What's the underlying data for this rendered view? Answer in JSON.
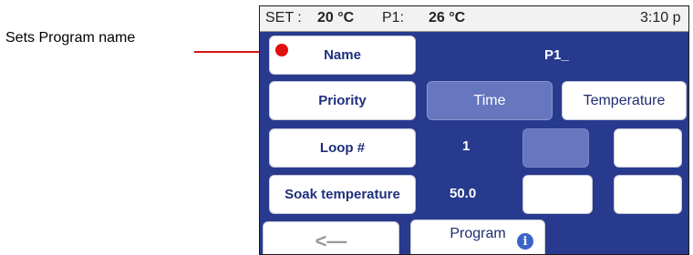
{
  "callout": {
    "label": "Sets Program name"
  },
  "status": {
    "set_label": "SET :",
    "set_value": "20 °C",
    "p1_label": "P1:",
    "p1_value": "26 °C",
    "time": "3:10 p"
  },
  "rows": {
    "name": {
      "button": "Name",
      "value": "P1_"
    },
    "priority": {
      "button": "Priority",
      "option_time": "Time",
      "option_temperature": "Temperature",
      "selected": "Time"
    },
    "loop": {
      "button": "Loop #",
      "value": "1"
    },
    "soak": {
      "button": "Soak temperature",
      "value": "50.0"
    }
  },
  "bottom": {
    "back_icon": "back-arrow-icon",
    "program_label": "Program",
    "info_icon": "i"
  },
  "colors": {
    "screen_bg": "#283a8e",
    "selected_bg": "#6676bf",
    "callout": "#e01010"
  }
}
